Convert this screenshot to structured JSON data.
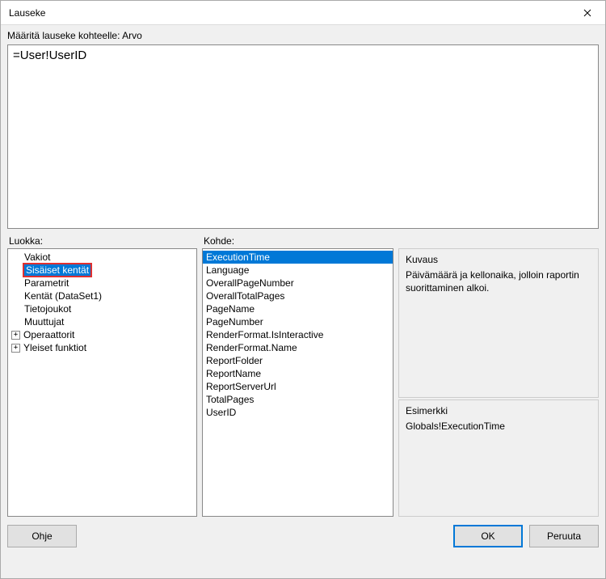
{
  "window": {
    "title": "Lauseke"
  },
  "instruction": "Määritä lauseke kohteelle: Arvo",
  "expression": "=User!UserID",
  "labels": {
    "category": "Luokka:",
    "item": "Kohde:",
    "description_title": "Kuvaus",
    "example_title": "Esimerkki"
  },
  "categories": [
    {
      "label": "Vakiot",
      "expandable": false,
      "indent": 1,
      "selected": false
    },
    {
      "label": "Sisäiset kentät",
      "expandable": false,
      "indent": 1,
      "selected": true,
      "highlighted": true
    },
    {
      "label": "Parametrit",
      "expandable": false,
      "indent": 1,
      "selected": false
    },
    {
      "label": "Kentät (DataSet1)",
      "expandable": false,
      "indent": 1,
      "selected": false
    },
    {
      "label": "Tietojoukot",
      "expandable": false,
      "indent": 1,
      "selected": false
    },
    {
      "label": "Muuttujat",
      "expandable": false,
      "indent": 1,
      "selected": false
    },
    {
      "label": "Operaattorit",
      "expandable": true,
      "indent": 0,
      "selected": false
    },
    {
      "label": "Yleiset funktiot",
      "expandable": true,
      "indent": 0,
      "selected": false
    }
  ],
  "items": [
    {
      "label": "ExecutionTime",
      "selected": true
    },
    {
      "label": "Language",
      "selected": false
    },
    {
      "label": "OverallPageNumber",
      "selected": false
    },
    {
      "label": "OverallTotalPages",
      "selected": false
    },
    {
      "label": "PageName",
      "selected": false
    },
    {
      "label": "PageNumber",
      "selected": false
    },
    {
      "label": "RenderFormat.IsInteractive",
      "selected": false
    },
    {
      "label": "RenderFormat.Name",
      "selected": false
    },
    {
      "label": "ReportFolder",
      "selected": false
    },
    {
      "label": "ReportName",
      "selected": false
    },
    {
      "label": "ReportServerUrl",
      "selected": false
    },
    {
      "label": "TotalPages",
      "selected": false
    },
    {
      "label": "UserID",
      "selected": false
    }
  ],
  "description_text": "Päivämäärä ja kellonaika, jolloin raportin suorittaminen alkoi.",
  "example_text": "Globals!ExecutionTime",
  "buttons": {
    "help": "Ohje",
    "ok": "OK",
    "cancel": "Peruuta"
  }
}
